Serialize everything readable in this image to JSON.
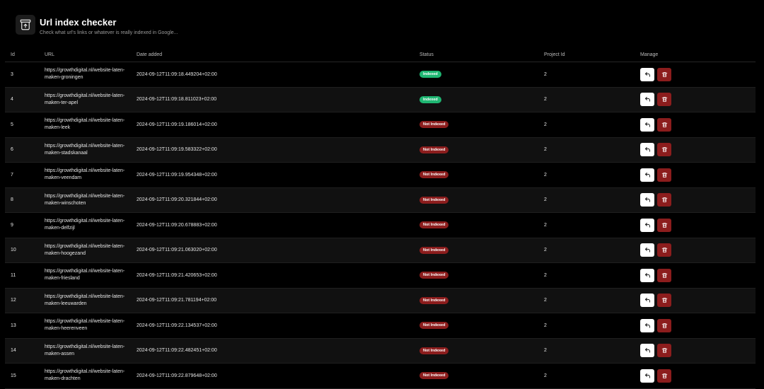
{
  "header": {
    "icon": "archive-upload-icon",
    "title": "Url index checker",
    "subtitle": "Check what url's links or whatever is really indexed in Google..."
  },
  "table": {
    "columns": [
      "Id",
      "URL",
      "Date added",
      "Status",
      "Project Id",
      "Manage"
    ],
    "rows": [
      {
        "id": "3",
        "url": "https://growthdigital.nl/website-laten-maken-groningen",
        "date": "2024-09-12T11:09:18.449204+02:00",
        "status": "Indexed",
        "project_id": "2"
      },
      {
        "id": "4",
        "url": "https://growthdigital.nl/website-laten-maken-ter-apel",
        "date": "2024-09-12T11:09:18.811023+02:00",
        "status": "Indexed",
        "project_id": "2"
      },
      {
        "id": "5",
        "url": "https://growthdigital.nl/website-laten-maken-leek",
        "date": "2024-09-12T11:09:19.186014+02:00",
        "status": "Not Indexed",
        "project_id": "2"
      },
      {
        "id": "6",
        "url": "https://growthdigital.nl/website-laten-maken-stadskanaal",
        "date": "2024-09-12T11:09:19.583322+02:00",
        "status": "Not Indexed",
        "project_id": "2"
      },
      {
        "id": "7",
        "url": "https://growthdigital.nl/website-laten-maken-veendam",
        "date": "2024-09-12T11:09:19.954348+02:00",
        "status": "Not Indexed",
        "project_id": "2"
      },
      {
        "id": "8",
        "url": "https://growthdigital.nl/website-laten-maken-winschoten",
        "date": "2024-09-12T11:09:20.321844+02:00",
        "status": "Not Indexed",
        "project_id": "2"
      },
      {
        "id": "9",
        "url": "https://growthdigital.nl/website-laten-maken-delfzijl",
        "date": "2024-09-12T11:09:20.678883+02:00",
        "status": "Not Indexed",
        "project_id": "2"
      },
      {
        "id": "10",
        "url": "https://growthdigital.nl/website-laten-maken-hoogezand",
        "date": "2024-09-12T11:09:21.063020+02:00",
        "status": "Not Indexed",
        "project_id": "2"
      },
      {
        "id": "11",
        "url": "https://growthdigital.nl/website-laten-maken-friesland",
        "date": "2024-09-12T11:09:21.420653+02:00",
        "status": "Not Indexed",
        "project_id": "2"
      },
      {
        "id": "12",
        "url": "https://growthdigital.nl/website-laten-maken-leeuwarden",
        "date": "2024-09-12T11:09:21.781194+02:00",
        "status": "Not Indexed",
        "project_id": "2"
      },
      {
        "id": "13",
        "url": "https://growthdigital.nl/website-laten-maken-heerenveen",
        "date": "2024-09-12T11:09:22.134537+02:00",
        "status": "Not Indexed",
        "project_id": "2"
      },
      {
        "id": "14",
        "url": "https://growthdigital.nl/website-laten-maken-assen",
        "date": "2024-09-12T11:09:22.482451+02:00",
        "status": "Not Indexed",
        "project_id": "2"
      },
      {
        "id": "15",
        "url": "https://growthdigital.nl/website-laten-maken-drachten",
        "date": "2024-09-12T11:09:22.879648+02:00",
        "status": "Not Indexed",
        "project_id": "2"
      }
    ],
    "manage_icons": {
      "reset": "undo-arrow-icon",
      "delete": "trash-icon"
    }
  },
  "colors": {
    "background": "#000000",
    "indexed": "#1fb672",
    "not_indexed": "#8c1d1d",
    "alt_row": "#111111"
  }
}
